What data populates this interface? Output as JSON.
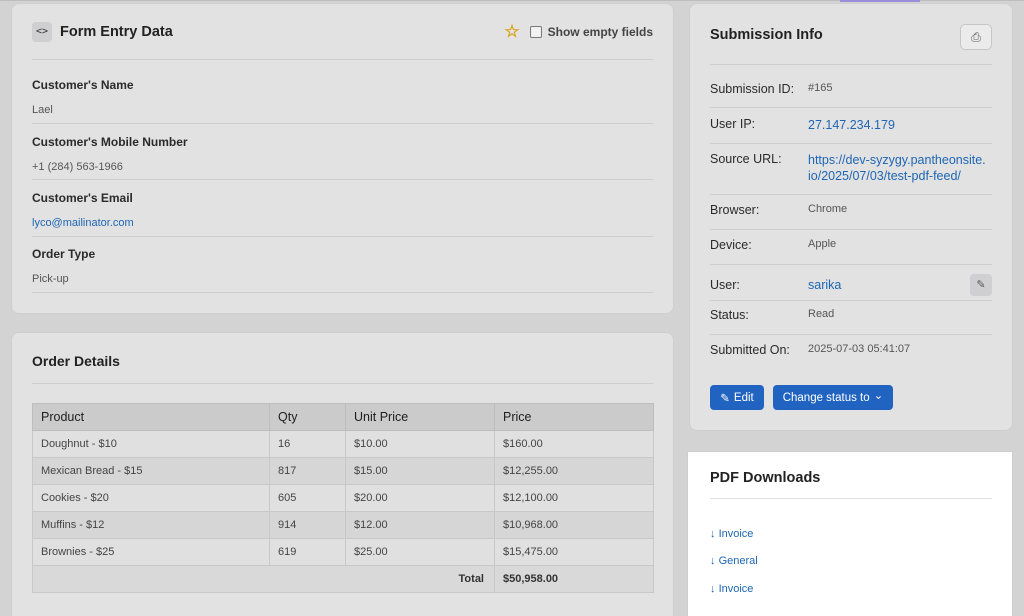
{
  "form_entry": {
    "title": "Form Entry Data",
    "code_icon": "<>",
    "show_empty_label": "Show empty fields",
    "fields": [
      {
        "label": "Customer's Name",
        "value": "Lael"
      },
      {
        "label": "Customer's Mobile Number",
        "value": "+1 (284) 563-1966"
      },
      {
        "label": "Customer's Email",
        "value": "lyco@mailinator.com"
      },
      {
        "label": "Order Type",
        "value": "Pick-up"
      }
    ]
  },
  "order_details": {
    "title": "Order Details",
    "columns": [
      "Product",
      "Qty",
      "Unit Price",
      "Price"
    ],
    "rows": [
      [
        "Doughnut - $10",
        "16",
        "$10.00",
        "$160.00"
      ],
      [
        "Mexican Bread - $15",
        "817",
        "$15.00",
        "$12,255.00"
      ],
      [
        "Cookies - $20",
        "605",
        "$20.00",
        "$12,100.00"
      ],
      [
        "Muffins - $12",
        "914",
        "$12.00",
        "$10,968.00"
      ],
      [
        "Brownies - $25",
        "619",
        "$25.00",
        "$15,475.00"
      ]
    ],
    "total_label": "Total",
    "total_value": "$50,958.00"
  },
  "submission": {
    "title": "Submission Info",
    "print_icon": "⎙",
    "id_label": "Submission ID:",
    "id_value": "#165",
    "ip_label": "User IP:",
    "ip_value": "27.147.234.179",
    "url_label": "Source URL:",
    "url_line1": "https://dev-syzygy.pantheonsite.",
    "url_line2": "io/2025/07/03/test-pdf-feed/",
    "browser_label": "Browser:",
    "browser_value": "Chrome",
    "device_label": "Device:",
    "device_value": "Apple",
    "user_label": "User:",
    "user_value": "sarika",
    "status_label": "Status:",
    "status_value": "Read",
    "submitted_label": "Submitted On:",
    "submitted_value": "2025-07-03 05:41:07",
    "edit_label": "Edit",
    "change_status_label": "Change status to",
    "edit_icon": "✎",
    "chevron_icon": "⌄"
  },
  "pdf": {
    "title": "PDF Downloads",
    "arrow": "↓",
    "links": [
      "Invoice",
      "General",
      "Invoice"
    ]
  }
}
